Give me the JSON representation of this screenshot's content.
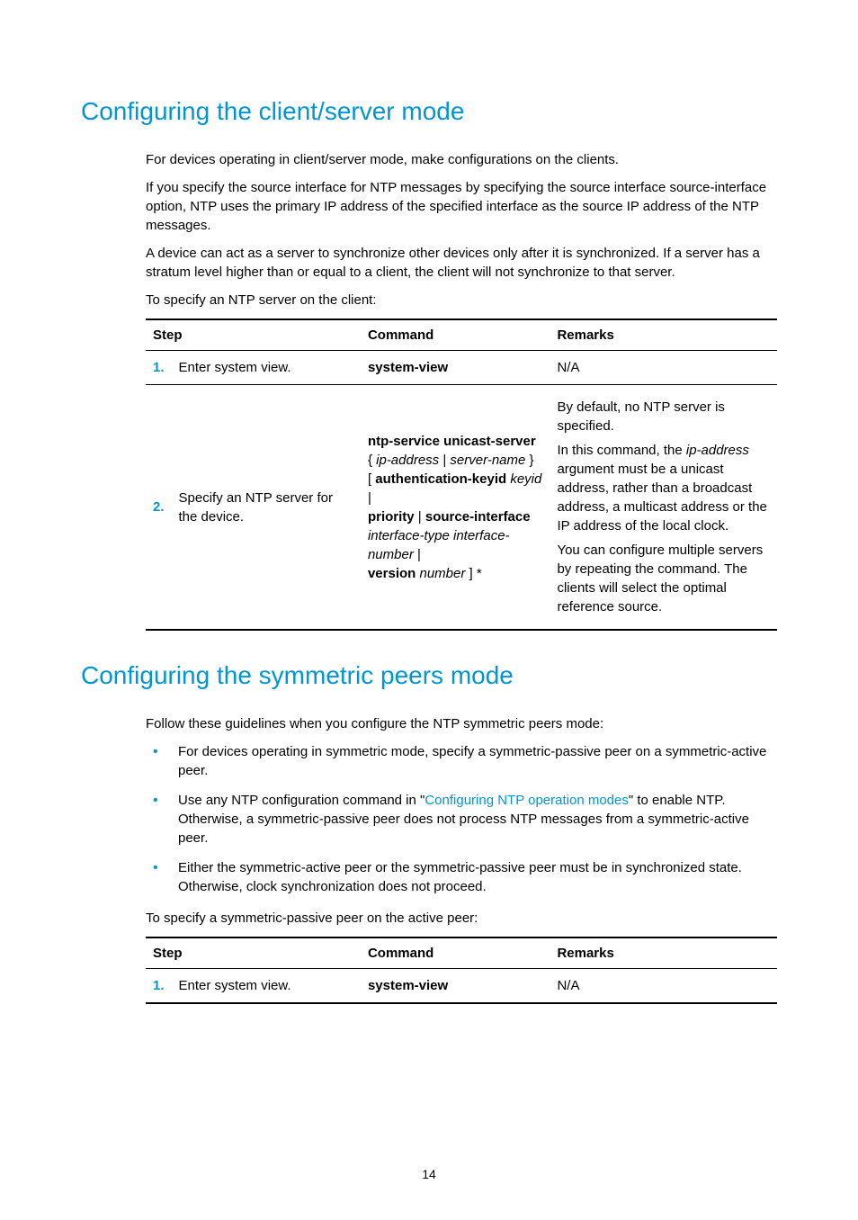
{
  "section1": {
    "title": "Configuring the client/server mode",
    "para1": "For devices operating in client/server mode, make configurations on the clients.",
    "para2": "If you specify the source interface for NTP messages by specifying the source interface source-interface option, NTP uses the primary IP address of the specified interface as the source IP address of the NTP messages.",
    "para3": "A device can act as a server to synchronize other devices only after it is synchronized. If a server has a stratum level higher than or equal to a client, the client will not synchronize to that server.",
    "para4": "To specify an NTP server on the client:",
    "table": {
      "headers": {
        "step": "Step",
        "command": "Command",
        "remarks": "Remarks"
      },
      "rows": [
        {
          "num": "1.",
          "step": "Enter system view.",
          "cmd_html": "<b>system-view</b>",
          "remarks_html": "N/A"
        },
        {
          "num": "2.",
          "step": "Specify an NTP server for the device.",
          "cmd_html": "<b>ntp-service unicast-server</b><br>{ <i>ip-address</i> | <i>server-name</i> }<br>[ <b>authentication-keyid</b> <i>keyid</i> |<br><b>priority</b> | <b>source-interface</b><br><i>interface-type interface-number</i> |<br><b>version</b> <i>number</i> ] *",
          "remarks_html": "<p>By default, no NTP server is specified.</p><p>In this command, the <i>ip-address</i> argument must be a unicast address, rather than a broadcast address, a multicast address or the IP address of the local clock.</p><p>You can configure multiple servers by repeating the command. The clients will select the optimal reference source.</p>"
        }
      ]
    }
  },
  "section2": {
    "title": "Configuring the symmetric peers mode",
    "para1": "Follow these guidelines when you configure the NTP symmetric peers mode:",
    "bullets": [
      {
        "html": "For devices operating in symmetric mode, specify a symmetric-passive peer on a symmetric-active peer."
      },
      {
        "html": "Use any NTP configuration command in \"<a class='xref' href='#'>Configuring NTP operation modes</a>\" to enable NTP. Otherwise, a symmetric-passive peer does not process NTP messages from a symmetric-active peer."
      },
      {
        "html": "Either the symmetric-active peer or the symmetric-passive peer must be in synchronized state. Otherwise, clock synchronization does not proceed."
      }
    ],
    "para2": "To specify a symmetric-passive peer on the active peer:",
    "table": {
      "headers": {
        "step": "Step",
        "command": "Command",
        "remarks": "Remarks"
      },
      "rows": [
        {
          "num": "1.",
          "step": "Enter system view.",
          "cmd_html": "<b>system-view</b>",
          "remarks_html": "N/A"
        }
      ]
    }
  },
  "page_number": "14"
}
